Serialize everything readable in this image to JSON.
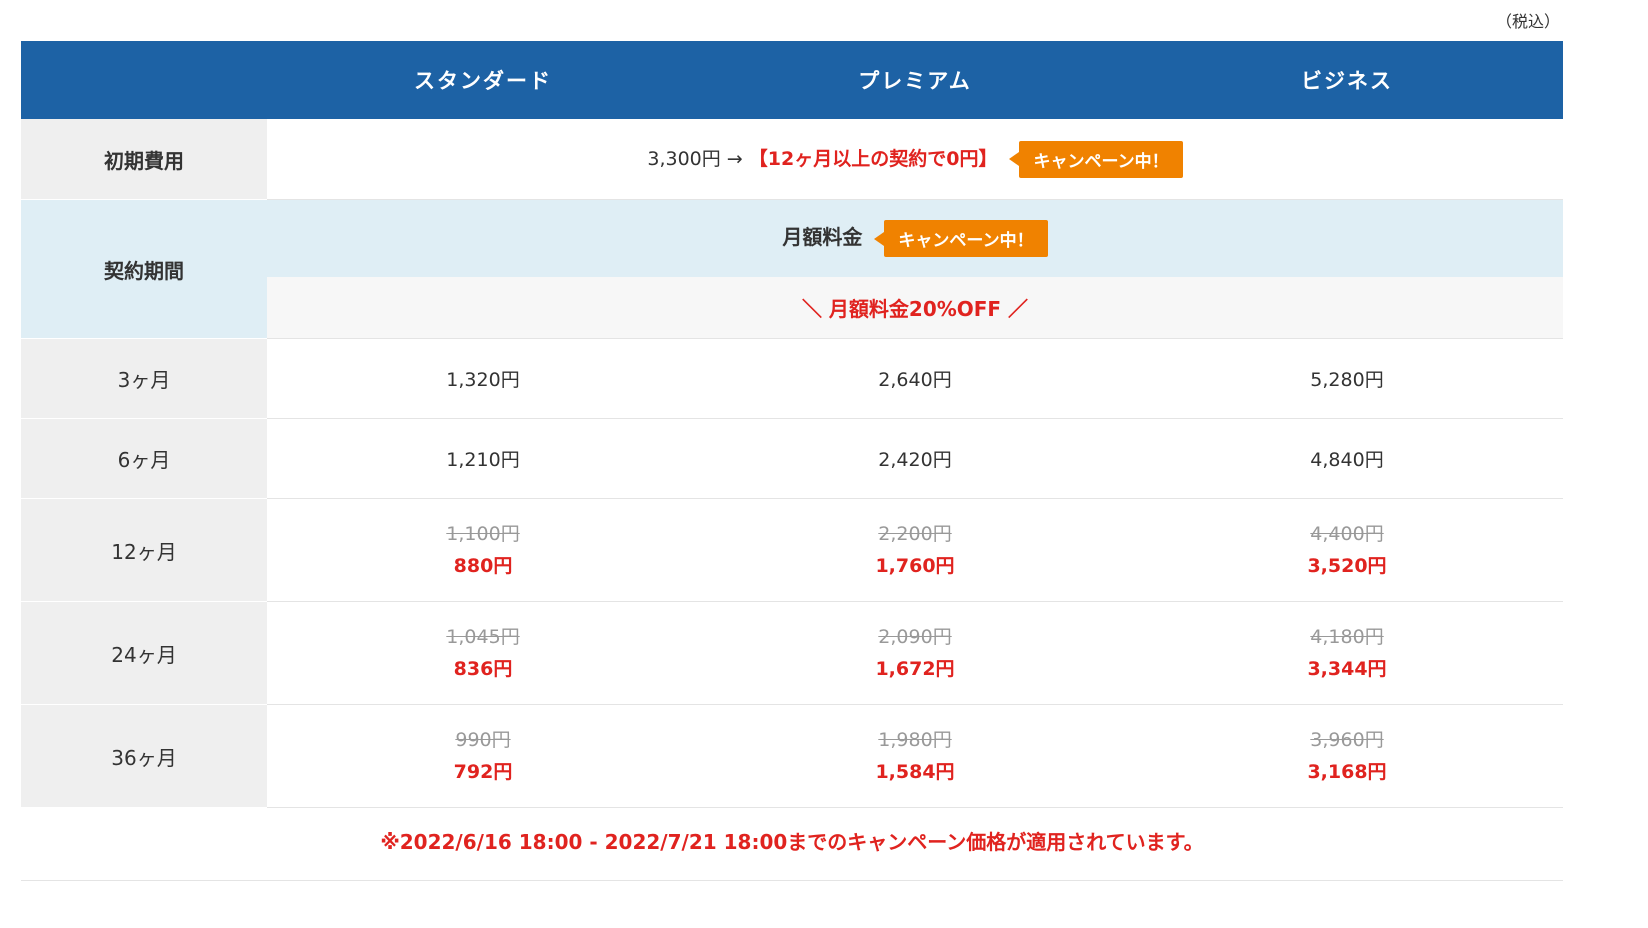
{
  "tax_note": "（税込）",
  "plans": [
    "スタンダード",
    "プレミアム",
    "ビジネス"
  ],
  "initial_fee": {
    "label": "初期費用",
    "price_text": "3,300円 → ",
    "campaign_text": "【12ヶ月以上の契約で0円】",
    "badge": "キャンペーン中！"
  },
  "contract": {
    "label": "契約期間",
    "monthly_label": "月額料金",
    "badge": "キャンペーン中！",
    "discount_banner": "＼ 月額料金20%OFF ／"
  },
  "rows": [
    {
      "period": "3ヶ月",
      "prices": [
        {
          "price": "1,320円"
        },
        {
          "price": "2,640円"
        },
        {
          "price": "5,280円"
        }
      ]
    },
    {
      "period": "6ヶ月",
      "prices": [
        {
          "price": "1,210円"
        },
        {
          "price": "2,420円"
        },
        {
          "price": "4,840円"
        }
      ]
    },
    {
      "period": "12ヶ月",
      "prices": [
        {
          "old": "1,100円",
          "new": "880円"
        },
        {
          "old": "2,200円",
          "new": "1,760円"
        },
        {
          "old": "4,400円",
          "new": "3,520円"
        }
      ]
    },
    {
      "period": "24ヶ月",
      "prices": [
        {
          "old": "1,045円",
          "new": "836円"
        },
        {
          "old": "2,090円",
          "new": "1,672円"
        },
        {
          "old": "4,180円",
          "new": "3,344円"
        }
      ]
    },
    {
      "period": "36ヶ月",
      "prices": [
        {
          "old": "990円",
          "new": "792円"
        },
        {
          "old": "1,980円",
          "new": "1,584円"
        },
        {
          "old": "3,960円",
          "new": "3,168円"
        }
      ]
    }
  ],
  "campaign_note": "※2022/6/16 18:00 - 2022/7/21 18:00までのキャンペーン価格が適用されています。",
  "colors": {
    "header_blue": "#1d62a5",
    "campaign_red": "#e0231f",
    "badge_orange": "#f08200",
    "light_blue": "#dfeef5"
  }
}
